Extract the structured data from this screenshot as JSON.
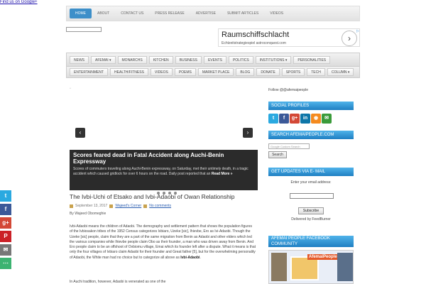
{
  "top_link": "Find us on Google+",
  "top_nav": [
    "HOME",
    "ABOUT",
    "CONTACT US",
    "PRESS RELEASE",
    "ADVERTISE",
    "SUBMIT ARTICLES",
    "VIDEOS"
  ],
  "ad": {
    "title": "Raumschiffschlacht",
    "subtitle": "Echtzeitstrategiespiel astroconquest.com",
    "button": "›"
  },
  "nav1": [
    "NEWS",
    "AFEMAI ▾",
    "MONARCHS",
    "KITCHEN",
    "BUSINESS",
    "EVENTS",
    "POLITICS",
    "INSTITUTIONS ▾",
    "PERSONALITIES"
  ],
  "nav2": [
    "ENTERTAINMENT",
    "HEALTH/FITNESS",
    "VIDEOS",
    "POEMS",
    "MARKET PLACE",
    "BLOG",
    "DONATE",
    "SPORTS",
    "TECH",
    "COLUMN ▾"
  ],
  "slider": {
    "title": "Scores feared dead in Fatal Accident along Auchi-Benin Expressway",
    "text": "Scores of commuters traveling along Auchi-Benin expressway, on Saturday, met their untimely death, in a tragic accident which caused gridlock for over 6 hours on the road. Daily post reported that an",
    "more": "Read More »",
    "prev": "‹",
    "next": "›"
  },
  "post": {
    "title": "The Ivbi-Uchi of Etsako and Ivbi-Adaobi of Owan Relationship",
    "date": "September 13, 2017",
    "category": "Wajeed's Corner",
    "comments": "No comments",
    "byline": "By Wajeed Obomeghie",
    "body": "Ivbi-Adaobi means the children of Adaobi. The demography and settlement pattern that shows the population figures of the Ivbiosakon tribes of the 1952 Census categorizes Ivbiaro, Uzeke [sic], Ihievbe, Ero as Ivi-Adaobi. Though the Uzeke [sic] people, claim that they are a part of the same migration from Benin as Adaobi and other elders which led the various companies while Ihievbe people claim Obo as their founder, a man who was driven away from Benin. And Ero people claim to be an offshoot of Ovbiomu village, Emai which its founder left after a dispute. What it means is that only the four villages of Ivbiaro claim Adaobi for their founder and Great father [5], but for the overwhelming personality of Adaobi, the White man had no choice but to categorize all above as",
    "body_bold": "Ivbi-Adaobi",
    "body2": "In Auchi tradition, however, Adaobi is venerated as one of the"
  },
  "sidebar": {
    "follow": "Follow @@afemaipeople",
    "social_head": "SOCIAL PROFILES",
    "search_head": "SEARCH AFEMAIPEOPLE.COM",
    "search_placeholder": "Google  Custom Search",
    "search_button": "Search",
    "email_head": "GET UPDATES VIA E- MAIL",
    "email_label": "Enter your email address:",
    "subscribe": "Subscribe",
    "delivered": "Delivered by FeedBurner",
    "fb_head": "AFEMAI PEOPLE FACEBOOK COMMUNITY",
    "fb_logo": "AfemaiPeople"
  },
  "social_icons": [
    {
      "name": "twitter-icon",
      "glyph": "t",
      "color": "#2aa9e0"
    },
    {
      "name": "facebook-icon",
      "glyph": "f",
      "color": "#3b5998"
    },
    {
      "name": "google-plus-icon",
      "glyph": "g+",
      "color": "#d34836"
    },
    {
      "name": "linkedin-icon",
      "glyph": "in",
      "color": "#0e76a8"
    },
    {
      "name": "rss-icon",
      "glyph": "◉",
      "color": "#f48a1f"
    },
    {
      "name": "email-icon",
      "glyph": "✉",
      "color": "#3a9b3a"
    }
  ],
  "share_icons": [
    {
      "name": "twitter-icon",
      "glyph": "t",
      "color": "#2aa9e0"
    },
    {
      "name": "facebook-icon",
      "glyph": "f",
      "color": "#3b5998"
    },
    {
      "name": "google-plus-icon",
      "glyph": "g+",
      "color": "#d34836"
    },
    {
      "name": "pinterest-icon",
      "glyph": "P",
      "color": "#cb2027"
    },
    {
      "name": "email-icon",
      "glyph": "✉",
      "color": "#777777"
    },
    {
      "name": "share-icon",
      "glyph": "⋯",
      "color": "#3cb371"
    }
  ]
}
